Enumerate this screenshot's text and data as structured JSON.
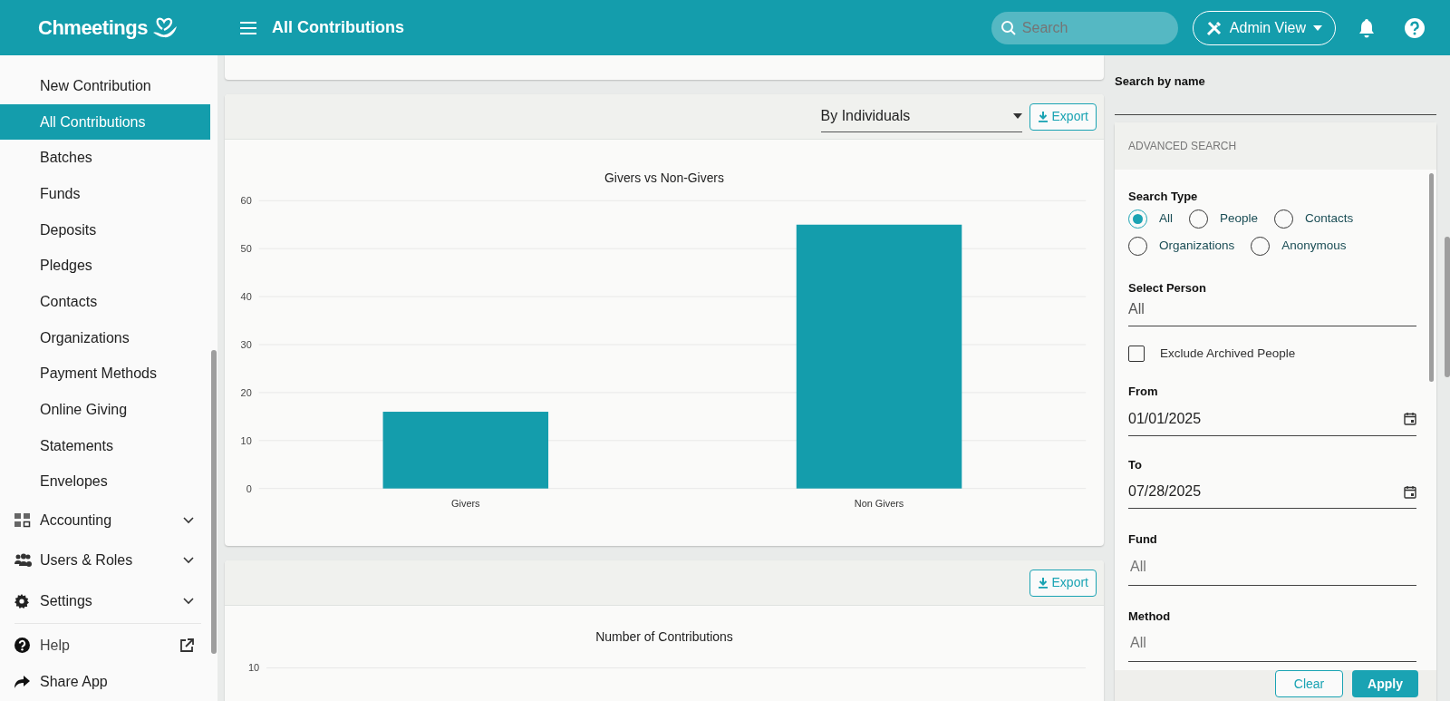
{
  "app": {
    "logo": "Chmeetings",
    "page_title": "All Contributions",
    "search": {
      "placeholder": "Search"
    },
    "view_button": "Admin View"
  },
  "sidebar": {
    "items": [
      {
        "label": "New Contribution",
        "kind": "link",
        "selected": false
      },
      {
        "label": "All Contributions",
        "kind": "link",
        "selected": true
      },
      {
        "label": "Batches",
        "kind": "link",
        "selected": false
      },
      {
        "label": "Funds",
        "kind": "link",
        "selected": false
      },
      {
        "label": "Deposits",
        "kind": "link",
        "selected": false
      },
      {
        "label": "Pledges",
        "kind": "link",
        "selected": false
      },
      {
        "label": "Contacts",
        "kind": "link",
        "selected": false
      },
      {
        "label": "Organizations",
        "kind": "link",
        "selected": false
      },
      {
        "label": "Payment Methods",
        "kind": "link",
        "selected": false
      },
      {
        "label": "Online Giving",
        "kind": "link",
        "selected": false
      },
      {
        "label": "Statements",
        "kind": "link",
        "selected": false
      },
      {
        "label": "Envelopes",
        "kind": "link",
        "selected": false
      },
      {
        "label": "Accounting",
        "kind": "group",
        "expanded": false
      },
      {
        "label": "Users & Roles",
        "kind": "group",
        "expanded": false
      },
      {
        "label": "Settings",
        "kind": "group",
        "expanded": false
      },
      {
        "label": "Help",
        "kind": "external"
      },
      {
        "label": "Share App",
        "kind": "share"
      }
    ]
  },
  "main": {
    "charts": [
      {
        "view_select": "By Individuals",
        "export": "Export",
        "chart_data": {
          "type": "bar",
          "title": "Givers vs Non-Givers",
          "categories": [
            "Givers",
            "Non Givers"
          ],
          "values": [
            16,
            55
          ],
          "ylim": [
            0,
            60
          ],
          "yticks": [
            0,
            10,
            20,
            30,
            40,
            50,
            60
          ],
          "grid": true
        }
      },
      {
        "export": "Export",
        "title": "Number of Contributions",
        "top_tick": "10"
      }
    ]
  },
  "filters": {
    "search_by_name": {
      "label": "Search by name"
    },
    "advanced": {
      "header": "ADVANCED SEARCH",
      "search_type": {
        "label": "Search Type",
        "options": [
          {
            "label": "All",
            "selected": true
          },
          {
            "label": "People",
            "selected": false
          },
          {
            "label": "Contacts",
            "selected": false
          },
          {
            "label": "Organizations",
            "selected": false
          },
          {
            "label": "Anonymous",
            "selected": false
          }
        ]
      },
      "select_person": {
        "label": "Select Person",
        "value": "All"
      },
      "exclude_archived": {
        "label": "Exclude Archived People",
        "checked": false
      },
      "from": {
        "label": "From",
        "value": "01/01/2025"
      },
      "to": {
        "label": "To",
        "value": "07/28/2025"
      },
      "fund": {
        "label": "Fund",
        "placeholder": "All"
      },
      "method": {
        "label": "Method",
        "placeholder": "All"
      },
      "buttons": {
        "clear": "Clear",
        "apply": "Apply"
      }
    }
  }
}
